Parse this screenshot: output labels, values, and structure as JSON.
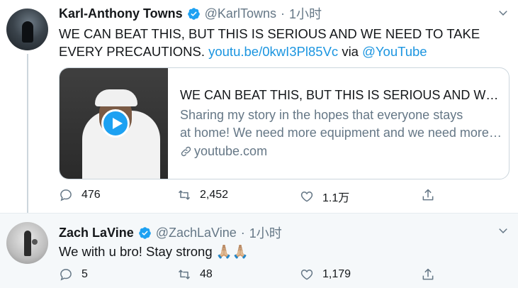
{
  "tweets": [
    {
      "name": "Karl-Anthony Towns",
      "handle": "@KarlTowns",
      "separator": "·",
      "time": "1小时",
      "text": "WE CAN BEAT THIS, BUT THIS IS SERIOUS AND WE NEED TO TAKE",
      "text_line2_prefix": "EVERY PRECAUTIONS.",
      "link": "youtu.be/0kwI3Pl85Vc",
      "via": "via",
      "mention": "@YouTube",
      "card": {
        "title": "WE CAN BEAT THIS, BUT THIS IS SERIOUS AND WE NEED TO TAKE EVERY PRECAUTIONS",
        "desc_line1": "Sharing my story in the hopes that everyone stays",
        "desc_line2": "at home! We need more equipment and we need more help",
        "domain": "youtube.com"
      },
      "replies": "476",
      "retweets": "2,452",
      "likes": "1.1万"
    },
    {
      "name": "Zach LaVine",
      "handle": "@ZachLaVine",
      "separator": "·",
      "time": "1小时",
      "text": "We with u bro! Stay strong 🙏🏼🙏🏼",
      "replies": "5",
      "retweets": "48",
      "likes": "1,179"
    }
  ],
  "colors": {
    "accent": "#1da1f2",
    "link": "#1b95e0",
    "muted": "#657786",
    "reply_bg": "#f5f8fa"
  },
  "icons": [
    "verified-badge-icon",
    "chevron-down-icon",
    "reply-icon",
    "retweet-icon",
    "like-icon",
    "share-icon",
    "link-icon",
    "play-icon"
  ]
}
